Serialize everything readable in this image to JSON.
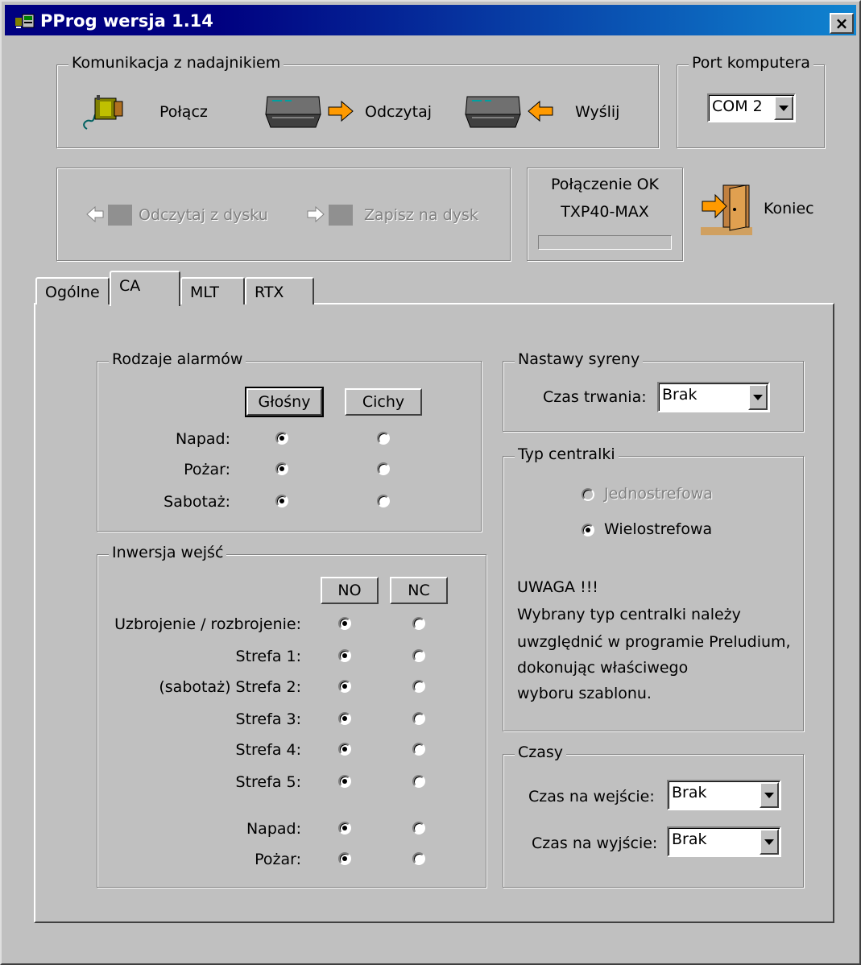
{
  "window": {
    "title": "PProg wersja 1.14",
    "close_label": "×"
  },
  "komunikacja": {
    "legend": "Komunikacja z nadajnikiem",
    "polacz_label": "Połącz",
    "odczytaj_label": "Odczytaj",
    "wyslij_label": "Wyślij"
  },
  "port": {
    "legend": "Port komputera",
    "value": "COM 2"
  },
  "disk": {
    "odczytaj_label": "Odczytaj z dysku",
    "zapisz_label": "Zapisz na dysk"
  },
  "status": {
    "line1": "Połączenie OK",
    "line2": "TXP40-MAX",
    "progress": 0
  },
  "koniec_label": "Koniec",
  "tabs": [
    {
      "label": "Ogólne"
    },
    {
      "label": "CA"
    },
    {
      "label": "MLT"
    },
    {
      "label": "RTX"
    }
  ],
  "alarmy": {
    "legend": "Rodzaje alarmów",
    "col1": "Głośny",
    "col2": "Cichy",
    "rows": [
      {
        "label": "Napad:",
        "selected": 1
      },
      {
        "label": "Pożar:",
        "selected": 1
      },
      {
        "label": "Sabotaż:",
        "selected": 1
      }
    ]
  },
  "inwersja": {
    "legend": "Inwersja wejść",
    "col1": "NO",
    "col2": "NC",
    "rows": [
      {
        "label": "Uzbrojenie / rozbrojenie:",
        "selected": 1
      },
      {
        "label": "Strefa 1:",
        "selected": 1
      },
      {
        "label": "(sabotaż) Strefa 2:",
        "selected": 1
      },
      {
        "label": "Strefa 3:",
        "selected": 1
      },
      {
        "label": "Strefa 4:",
        "selected": 1
      },
      {
        "label": "Strefa 5:",
        "selected": 1
      },
      {
        "label": "Napad:",
        "selected": 1
      },
      {
        "label": "Pożar:",
        "selected": 1
      }
    ]
  },
  "syrena": {
    "legend": "Nastawy syreny",
    "czas_label": "Czas trwania:",
    "czas_value": "Brak"
  },
  "typ": {
    "legend": "Typ centralki",
    "opt1": "Jednostrefowa",
    "opt2": "Wielostrefowa",
    "warn_title": "UWAGA !!!",
    "warn_lines": [
      "Wybrany typ centralki należy",
      "uwzględnić w programie Preludium,",
      "dokonując właściwego",
      "wyboru szablonu."
    ]
  },
  "czasy": {
    "legend": "Czasy",
    "wejscie_label": "Czas na wejście:",
    "wejscie_value": "Brak",
    "wyjscie_label": "Czas na wyjście:",
    "wyjscie_value": "Brak"
  }
}
